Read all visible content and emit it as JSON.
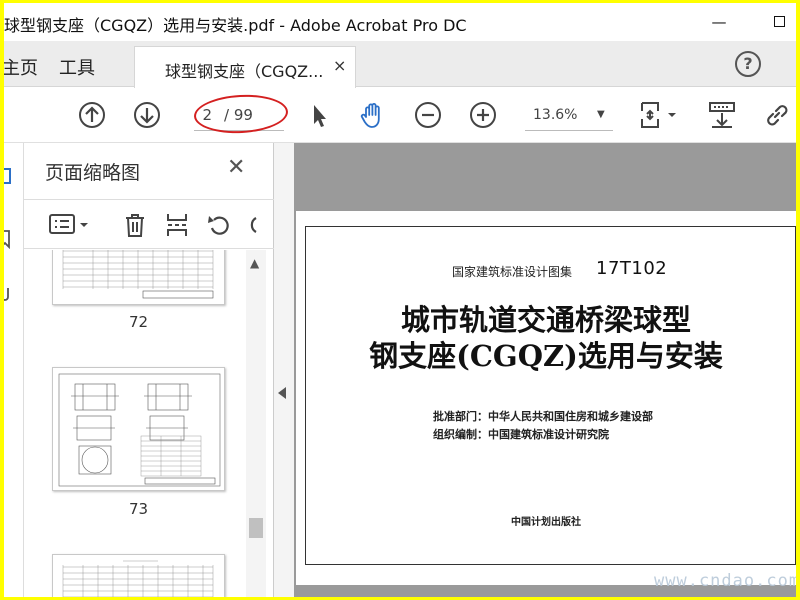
{
  "window": {
    "title": "球型钢支座（CGQZ）选用与安装.pdf - Adobe Acrobat Pro DC",
    "minimize_glyph": "—",
    "border_color": "#ffff00"
  },
  "tabbar": {
    "home_label": "主页",
    "tools_label": "工具",
    "document_tab_label": "球型钢支座（CGQZ...",
    "document_tab_close": "×",
    "help_glyph": "?"
  },
  "toolbar": {
    "current_page": "2",
    "page_total": "/ 99",
    "zoom": "13.6%",
    "zoom_arrow": "▼",
    "icons": [
      "page-up-icon",
      "page-down-icon",
      "select-arrow-icon",
      "hand-tool-icon",
      "zoom-out-icon",
      "zoom-in-icon",
      "fit-page-icon",
      "scroll-mode-icon",
      "link-icon"
    ],
    "annotation_color": "#d42020",
    "hand_tool_color": "#2b6fc7"
  },
  "thumbnails": {
    "title": "页面缩略图",
    "close_glyph": "✕",
    "pages": [
      {
        "number": "72"
      },
      {
        "number": "73"
      }
    ],
    "scroll_up_glyph": "▲"
  },
  "document": {
    "atlas_label": "国家建筑标准设计图集",
    "atlas_code": "17T102",
    "title_line1": "城市轨道交通桥梁球型",
    "title_line2": "钢支座(CGQZ)选用与安装",
    "approved_by": "批准部门：中华人民共和国住房和城乡建设部",
    "compiled_by": "组织编制：中国建筑标准设计研究院",
    "publisher": "中国计划出版社"
  },
  "watermark": {
    "text": "www.cndao.com"
  }
}
